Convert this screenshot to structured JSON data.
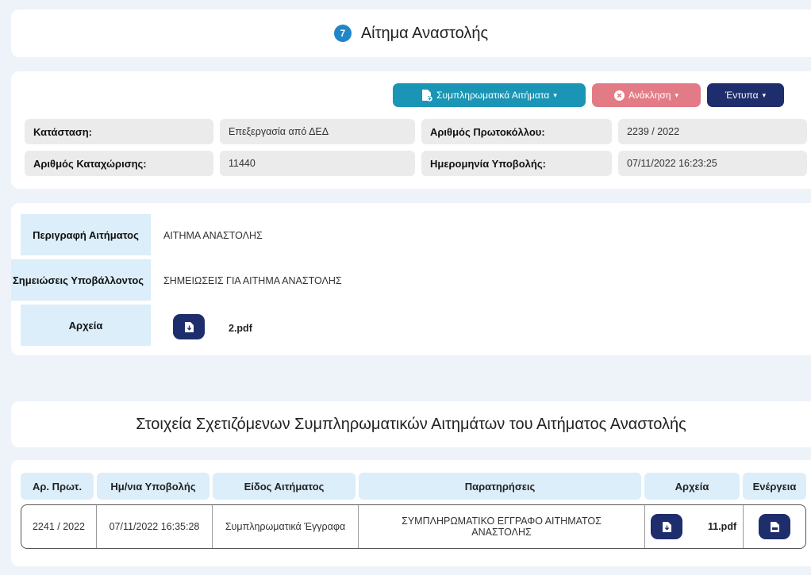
{
  "header": {
    "step_number": "7",
    "title": "Αίτημα Αναστολής"
  },
  "toolbar": {
    "supplementary_label": "Συμπληρωματικά Αιτήματα",
    "revoke_label": "Ανάκληση",
    "forms_label": "Έντυπα"
  },
  "info": {
    "status_label": "Κατάσταση:",
    "status_value": "Επεξεργασία από ΔΕΔ",
    "protocol_label": "Αριθμός Πρωτοκόλλου:",
    "protocol_value": "2239 / 2022",
    "registration_label": "Αριθμός Καταχώρισης:",
    "registration_value": "11440",
    "submission_label": "Ημερομηνία Υποβολής:",
    "submission_value": "07/11/2022 16:23:25"
  },
  "details": {
    "description_label": "Περιγραφή Αιτήματος",
    "description_value": "ΑΙΤΗΜΑ ΑΝΑΣΤΟΛΗΣ",
    "notes_label": "Σημειώσεις Υποβάλλοντος",
    "notes_value": "ΣΗΜΕΙΩΣΕΙΣ ΓΙΑ ΑΙΤΗΜΑ ΑΝΑΣΤΟΛΗΣ",
    "files_label": "Αρχεία",
    "file_name": "2.pdf"
  },
  "related": {
    "title": "Στοιχεία Σχετιζόμενων Συμπληρωματικών Αιτημάτων του Αιτήματος Αναστολής",
    "columns": [
      "Αρ. Πρωτ.",
      "Ημ/νια Υποβολής",
      "Είδος Αιτήματος",
      "Παρατηρήσεις",
      "Αρχεία",
      "Ενέργεια"
    ],
    "rows": [
      {
        "protocol": "2241 / 2022",
        "date": "07/11/2022 16:35:28",
        "type": "Συμπληρωματικά Έγγραφα",
        "notes": "ΣΥΜΠΛΗΡΩΜΑΤΙΚΟ ΕΓΓΡΑΦΟ ΑΙΤΗΜΑΤΟΣ ΑΝΑΣΤΟΛΗΣ",
        "file": "11.pdf"
      }
    ]
  },
  "colors": {
    "teal": "#1a95b6",
    "pink": "#e37b86",
    "navy": "#1e2d6b",
    "badge": "#1f86c8",
    "label_bg": "#dbeefa"
  },
  "icons": {
    "supplementary": "file-plus-icon",
    "revoke": "x-circle-icon",
    "download": "file-download-icon",
    "pdf": "pdf-file-icon"
  }
}
